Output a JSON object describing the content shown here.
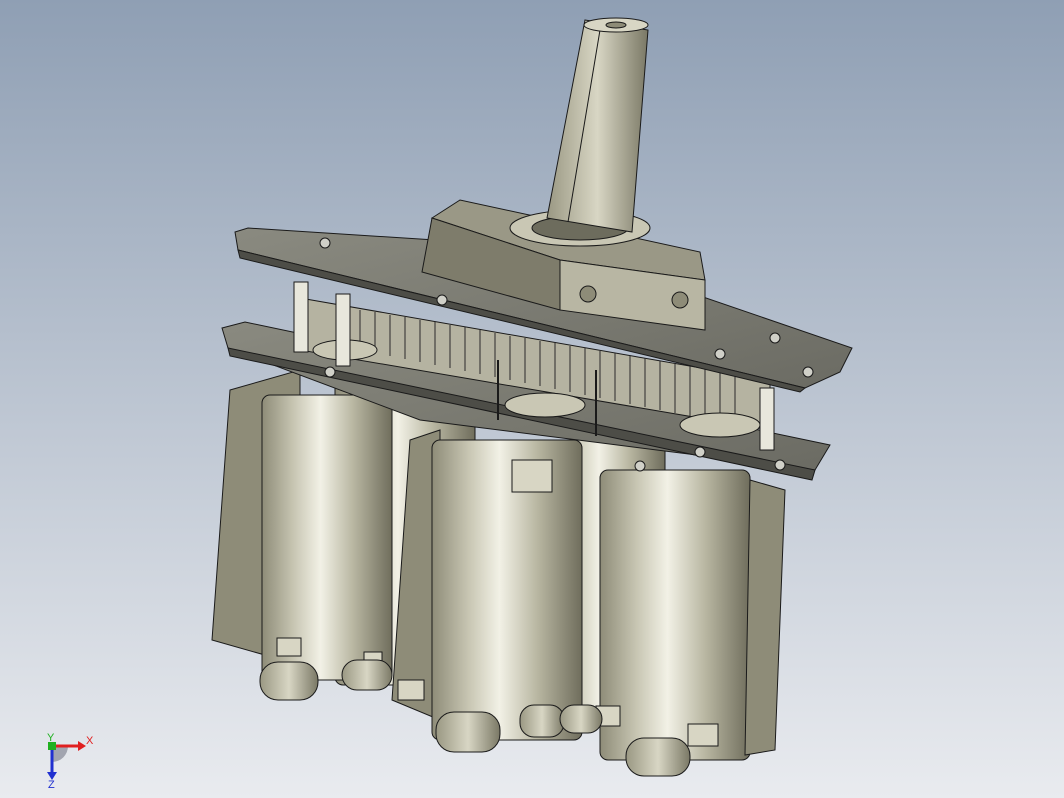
{
  "viewport": {
    "background_top": "#8f9fb4",
    "background_bottom": "#e9ebef"
  },
  "model": {
    "label": "gearmotor-assembly",
    "metal_color": "#c9c7b4",
    "metal_shadow": "#8e8c78",
    "plate_color": "#7b7b72",
    "edge_color": "#1a1a1a"
  },
  "triad": {
    "x_label": "X",
    "y_label": "Y",
    "z_label": "Z",
    "x_color": "#e02020",
    "y_color": "#20b020",
    "z_color": "#2030d0"
  }
}
